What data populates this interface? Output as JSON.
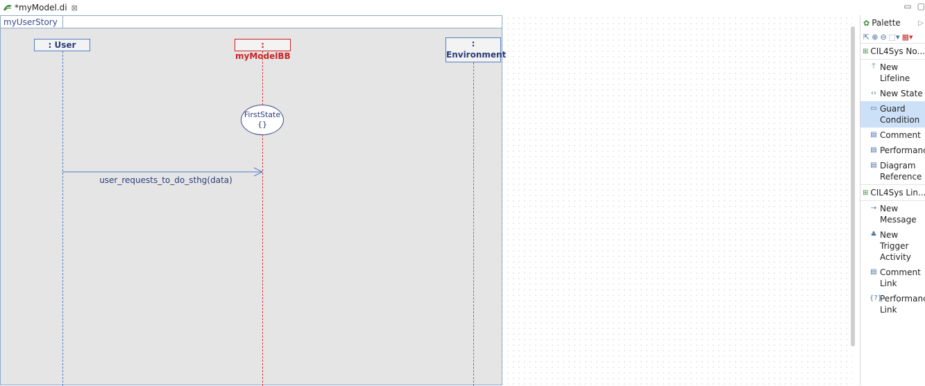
{
  "editor": {
    "tab_title": "*myModel.di",
    "tab_close": "⊠",
    "window_controls": [
      "▭",
      "▢"
    ]
  },
  "diagram": {
    "frame_title": "myUserStory",
    "lifelines": [
      {
        "label": ": User",
        "color": "#4f7ec4"
      },
      {
        "label": ": myModelBB",
        "color": "#cc2222"
      },
      {
        "label": ":\nEnvironment",
        "color": "#4f7ec4"
      }
    ],
    "state": {
      "name": "FirstState",
      "body": "{}"
    },
    "message": {
      "label": "user_requests_to_do_sthg(data)"
    }
  },
  "palette": {
    "title": "Palette",
    "tools": [
      "select-icon",
      "zoom-in-icon",
      "zoom-out-icon",
      "marquee-icon",
      "layout-icon"
    ],
    "drawers": [
      {
        "label": "CIL4Sys No...",
        "items": [
          {
            "label": "New Lifeline",
            "icon": "lifeline-icon"
          },
          {
            "label": "New State",
            "icon": "state-icon"
          },
          {
            "label": "Guard\nCondition",
            "icon": "guard-icon",
            "selected": true
          },
          {
            "label": "Comment",
            "icon": "comment-icon"
          },
          {
            "label": "Performance",
            "icon": "performance-icon"
          },
          {
            "label": "Diagram\nReference",
            "icon": "diagram-reference-icon"
          }
        ]
      },
      {
        "label": "CIL4Sys Lin...",
        "items": [
          {
            "label": "New\nMessage",
            "icon": "message-icon"
          },
          {
            "label": "New Trigger\nActivity",
            "icon": "trigger-icon"
          },
          {
            "label": "Comment\nLink",
            "icon": "comment-link-icon"
          },
          {
            "label": "Performance\nLink",
            "icon": "performance-link-icon"
          }
        ]
      }
    ]
  }
}
